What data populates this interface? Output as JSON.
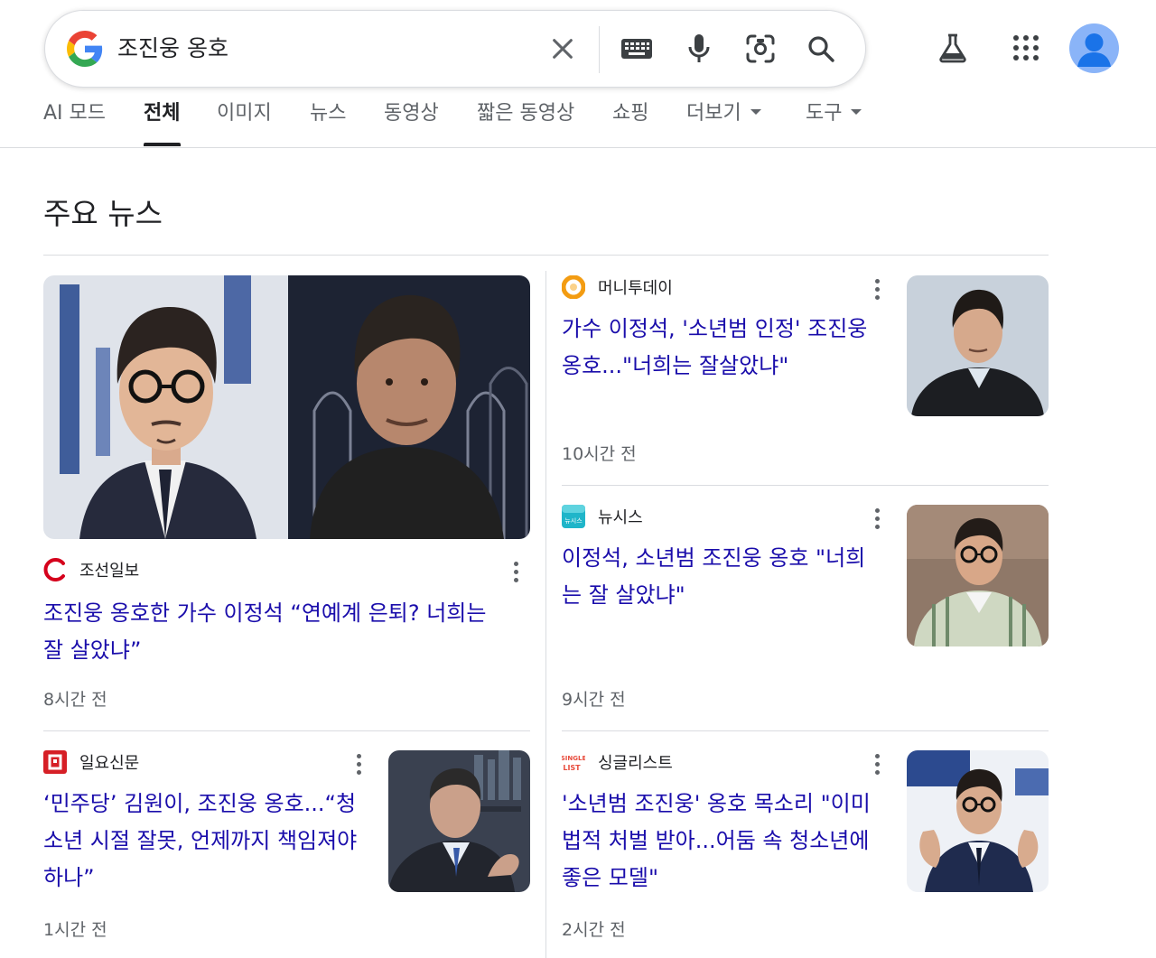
{
  "search": {
    "query": "조진웅 옹호"
  },
  "header": {
    "icons": [
      "labs-flask-icon",
      "apps-grid-icon",
      "account-avatar-icon"
    ]
  },
  "tabs": [
    {
      "label": "AI 모드"
    },
    {
      "label": "전체"
    },
    {
      "label": "이미지"
    },
    {
      "label": "뉴스"
    },
    {
      "label": "동영상"
    },
    {
      "label": "짧은 동영상"
    },
    {
      "label": "쇼핑"
    },
    {
      "label": "더보기"
    },
    {
      "label": "도구"
    }
  ],
  "active_tab": "전체",
  "section": {
    "title": "주요 뉴스"
  },
  "articles": [
    {
      "source": "조선일보",
      "headline_line1": "조진웅 옹호한 가수 이정석 “연예계 은퇴? 너희는",
      "headline_line2": "잘 살았냐”",
      "time": "8시간 전"
    },
    {
      "source": "머니투데이",
      "headline_line1": "가수 이정석, '소년범 인정' 조진웅",
      "headline_line2": "옹호...\"너희는 잘살았냐\"",
      "time": "10시간 전"
    },
    {
      "source": "뉴시스",
      "source_logo_text": "뉴시스",
      "headline_line1": "이정석, 소년범 조진웅 옹호 \"너희",
      "headline_line2": "는 잘 살았냐\"",
      "time": "9시간 전"
    },
    {
      "source": "일요신문",
      "headline_line1": "‘민주당’ 김원이, 조진웅 옹호...“청",
      "headline_line2": "소년 시절 잘못, 언제까지 책임져야",
      "headline_line3": "하나”",
      "time": "1시간 전"
    },
    {
      "source": "싱글리스트",
      "source_logo_text_1": "SINGLE",
      "source_logo_text_2": "LIST",
      "headline_line1": "'소년범 조진웅' 옹호 목소리 \"이미",
      "headline_line2": "법적 처벌 받아...어둠 속 청소년에",
      "headline_line3": "좋은 모델\"",
      "time": "2시간 전"
    }
  ],
  "colors": {
    "link": "#1a0dab",
    "secondary_text": "#5f6368",
    "divider": "#dadce0",
    "avatar": "#8ab4f8"
  }
}
